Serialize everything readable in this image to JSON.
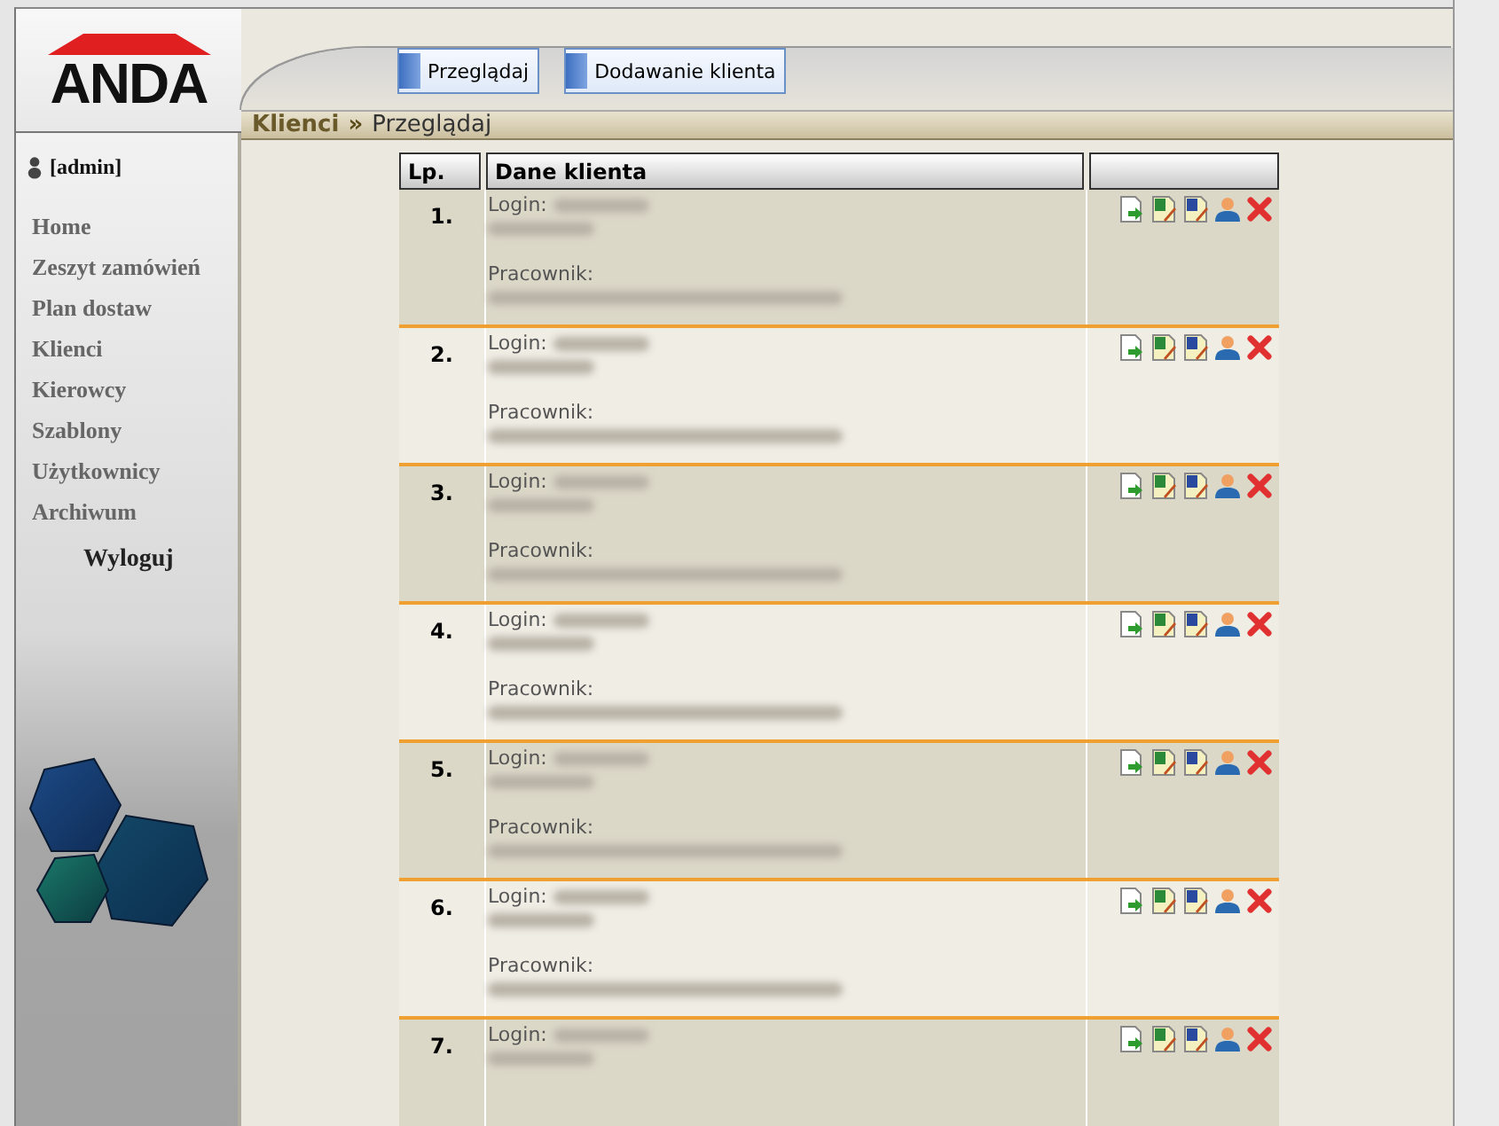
{
  "logo": {
    "text": "ANDA"
  },
  "toolbar": {
    "buttons": [
      {
        "label": "Przeglądaj"
      },
      {
        "label": "Dodawanie klienta"
      }
    ]
  },
  "user": {
    "label": "[admin]"
  },
  "sidebar": {
    "items": [
      {
        "label": "Home"
      },
      {
        "label": "Zeszyt zamówień"
      },
      {
        "label": "Plan dostaw"
      },
      {
        "label": "Klienci"
      },
      {
        "label": "Kierowcy"
      },
      {
        "label": "Szablony"
      },
      {
        "label": "Użytkownicy"
      },
      {
        "label": "Archiwum"
      }
    ],
    "logout": "Wyloguj"
  },
  "breadcrumb": {
    "section": "Klienci",
    "separator": "»",
    "page": "Przeglądaj"
  },
  "table": {
    "columns": [
      "Lp.",
      "Dane klienta"
    ],
    "rows": [
      {
        "number": "1.",
        "login_label": "Login:",
        "employee_label": "Pracownik:"
      },
      {
        "number": "2.",
        "login_label": "Login:",
        "employee_label": "Pracownik:"
      },
      {
        "number": "3.",
        "login_label": "Login:",
        "employee_label": "Pracownik:"
      },
      {
        "number": "4.",
        "login_label": "Login:",
        "employee_label": "Pracownik:"
      },
      {
        "number": "5.",
        "login_label": "Login:",
        "employee_label": "Pracownik:"
      },
      {
        "number": "6.",
        "login_label": "Login:",
        "employee_label": "Pracownik:"
      },
      {
        "number": "7.",
        "login_label": "Login:"
      }
    ]
  }
}
